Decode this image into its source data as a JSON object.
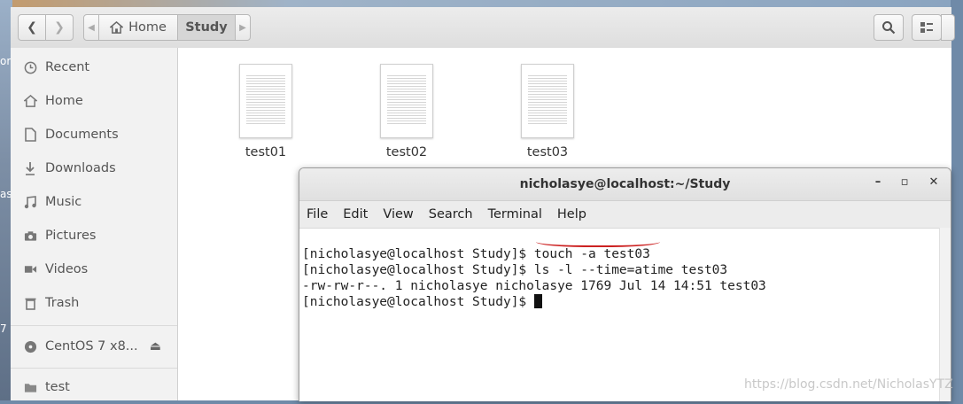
{
  "desktop": {
    "labels": [
      "om",
      "as",
      "7"
    ]
  },
  "headerbar": {
    "back_icon": "chevron-left-icon",
    "forward_icon": "chevron-right-icon",
    "breadcrumb": [
      {
        "label": "Home",
        "icon": "home-icon"
      },
      {
        "label": "Study"
      }
    ]
  },
  "sidebar": {
    "items": [
      {
        "label": "Recent",
        "icon": "clock-icon"
      },
      {
        "label": "Home",
        "icon": "home-icon"
      },
      {
        "label": "Documents",
        "icon": "document-icon"
      },
      {
        "label": "Downloads",
        "icon": "download-icon"
      },
      {
        "label": "Music",
        "icon": "music-icon"
      },
      {
        "label": "Pictures",
        "icon": "camera-icon"
      },
      {
        "label": "Videos",
        "icon": "video-icon"
      },
      {
        "label": "Trash",
        "icon": "trash-icon"
      },
      {
        "label": "CentOS 7 x8...",
        "icon": "disc-icon"
      },
      {
        "label": "test",
        "icon": "folder-icon"
      }
    ]
  },
  "files": [
    {
      "name": "test01"
    },
    {
      "name": "test02"
    },
    {
      "name": "test03"
    }
  ],
  "terminal": {
    "title": "nicholasye@localhost:~/Study",
    "menu": [
      "File",
      "Edit",
      "View",
      "Search",
      "Terminal",
      "Help"
    ],
    "lines": [
      "[nicholasye@localhost Study]$ touch -a test03",
      "[nicholasye@localhost Study]$ ls -l --time=atime test03",
      "-rw-rw-r--. 1 nicholasye nicholasye 1769 Jul 14 14:51 test03",
      "[nicholasye@localhost Study]$ "
    ],
    "controls": {
      "minimize": "–",
      "maximize": "▫",
      "close": "✕"
    }
  },
  "watermark": "https://blog.csdn.net/NicholasYTZ",
  "colors": {
    "annotation_red": "#cc2222"
  }
}
